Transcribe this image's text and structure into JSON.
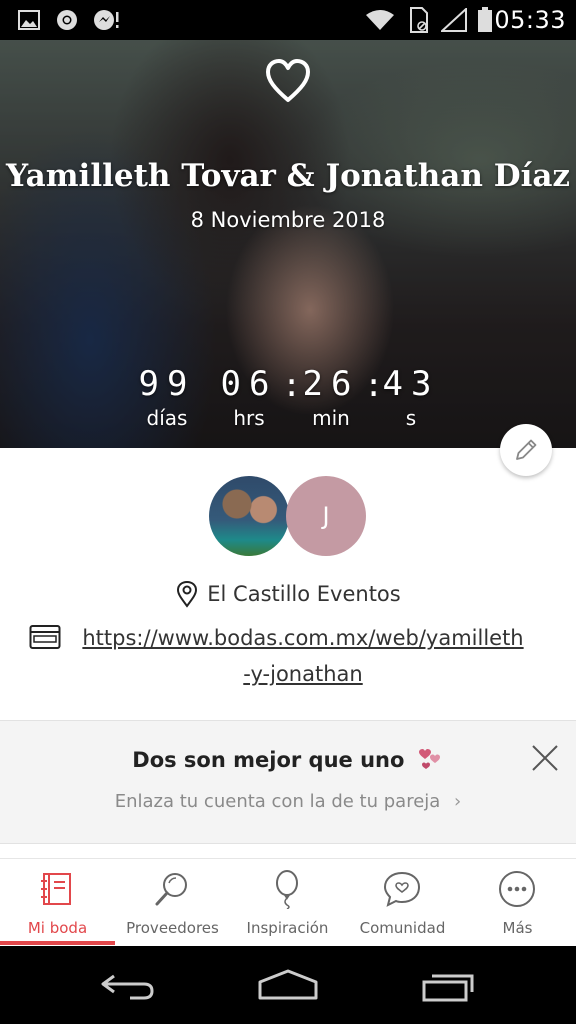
{
  "status_bar": {
    "time": "05:33",
    "icons": [
      "image-icon",
      "chrome-icon",
      "messenger-icon",
      "wifi-icon",
      "sim-icon",
      "signal-icon",
      "battery-icon"
    ]
  },
  "hero": {
    "couple_names": "Yamilleth Tovar & Jonathan Díaz",
    "date": "8 Noviembre 2018",
    "countdown": {
      "days": "99",
      "days_label": "días",
      "hours": "06",
      "hours_label": "hrs",
      "minutes": "26",
      "minutes_label": "min",
      "seconds": "43",
      "seconds_label": "s",
      "separator": ":"
    }
  },
  "profile": {
    "partner_initial": "J",
    "partner_avatar_color": "#c49aa3",
    "venue": "El Castillo Eventos",
    "website_line1": "https://www.bodas.com.mx/web/yamilleth",
    "website_line2": "-y-jonathan"
  },
  "partner_banner": {
    "title": "Dos son mejor que uno",
    "subtitle": "Enlaza tu cuenta con la de tu pareja",
    "chevron": "›"
  },
  "bottom_nav": {
    "accent_color": "#e2474b",
    "items": [
      {
        "label": "Mi boda",
        "icon": "notebook-icon",
        "active": true
      },
      {
        "label": "Proveedores",
        "icon": "search-icon",
        "active": false
      },
      {
        "label": "Inspiración",
        "icon": "balloon-icon",
        "active": false
      },
      {
        "label": "Comunidad",
        "icon": "chat-heart-icon",
        "active": false
      },
      {
        "label": "Más",
        "icon": "more-icon",
        "active": false
      }
    ]
  }
}
